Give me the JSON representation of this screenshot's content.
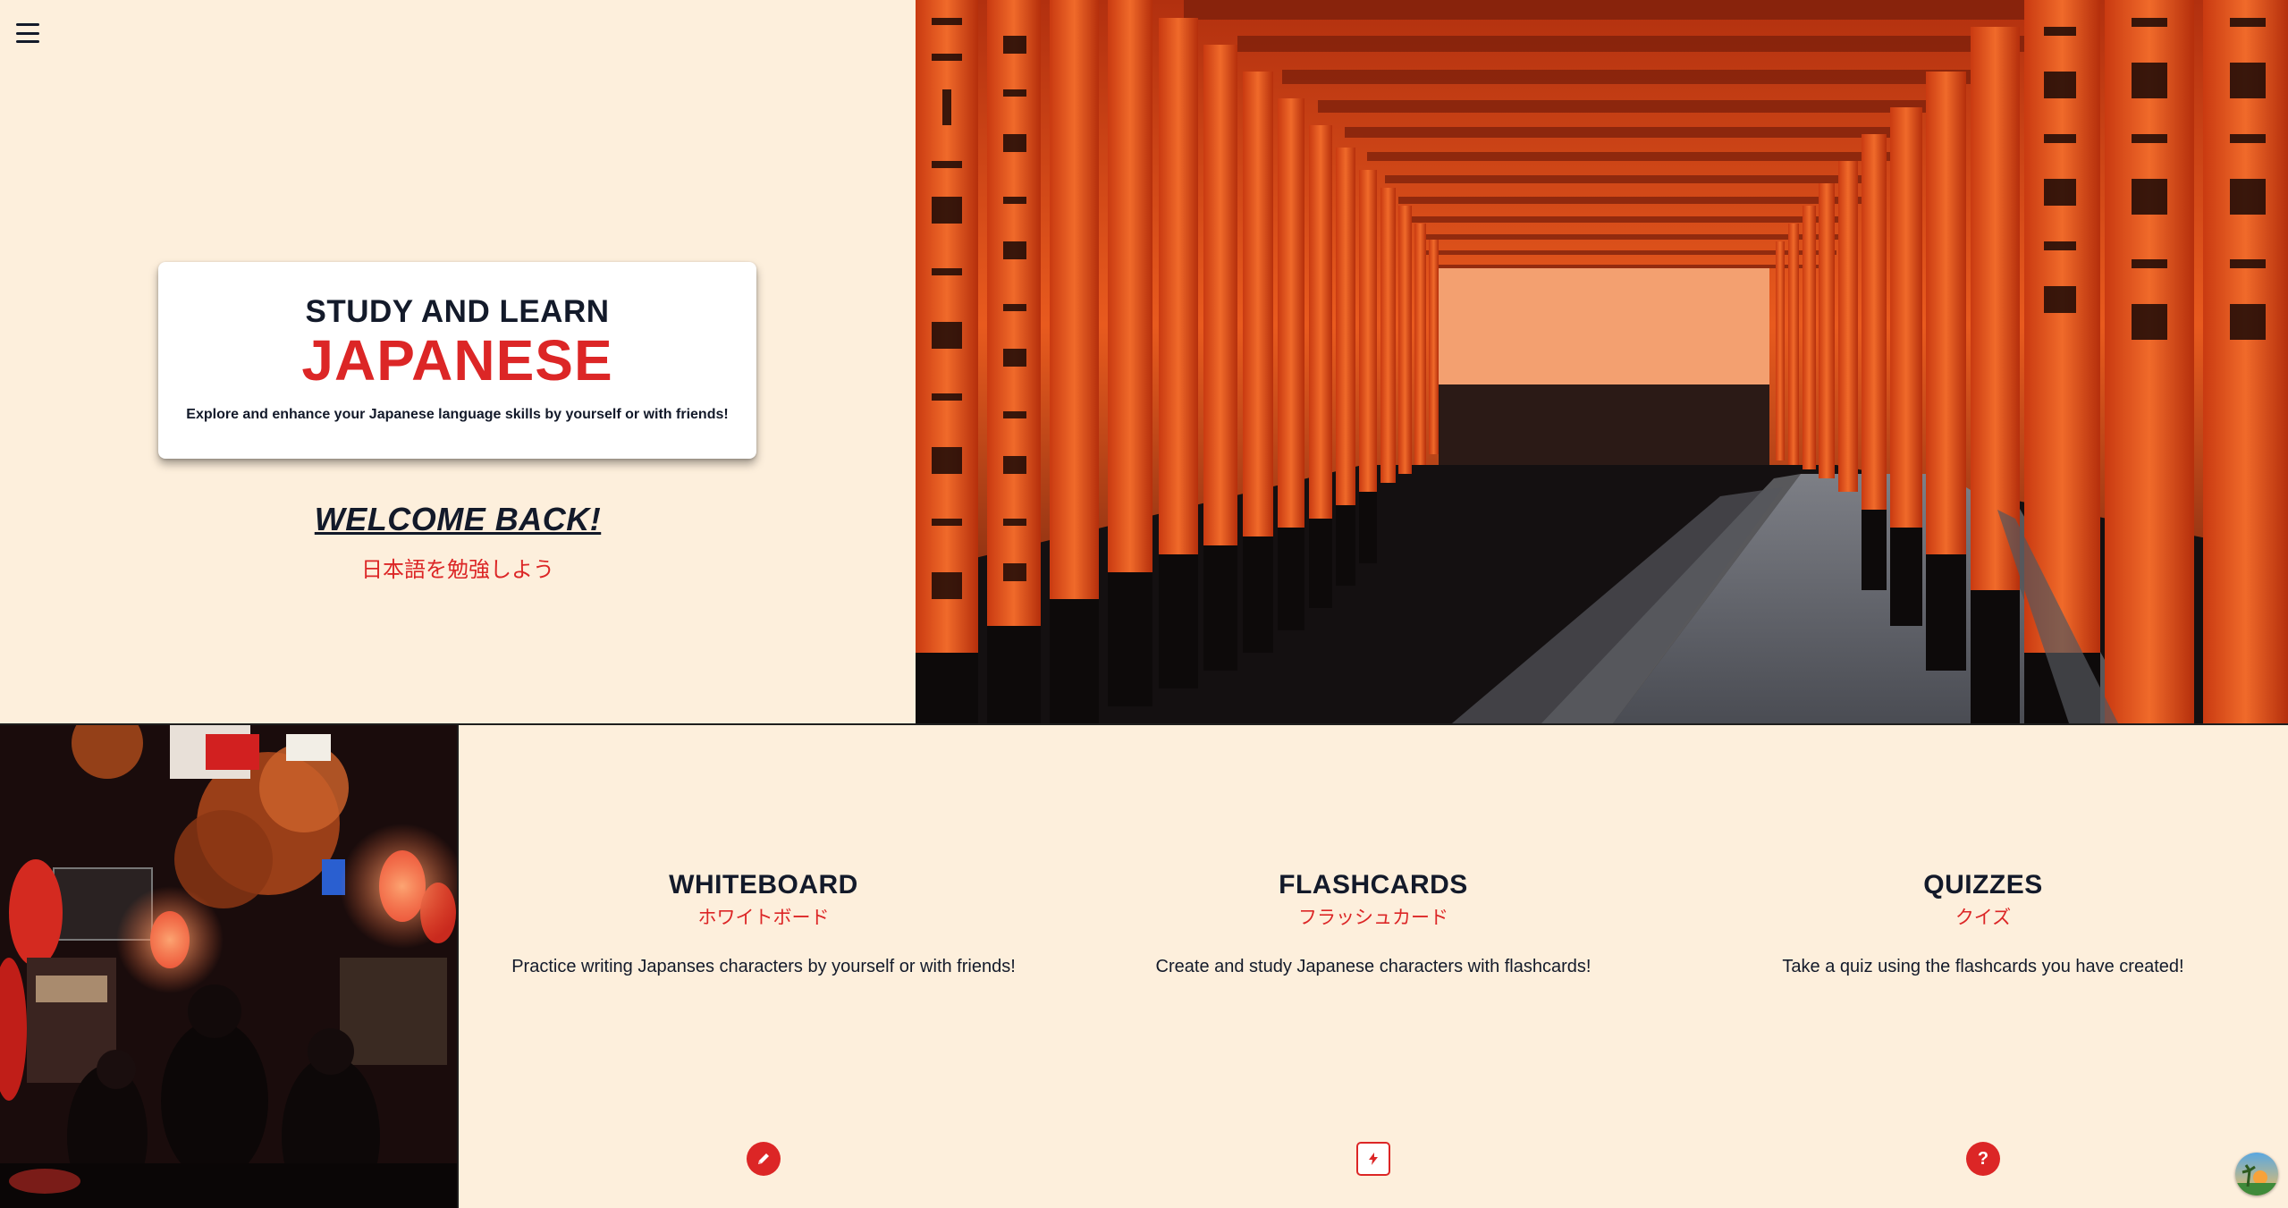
{
  "nav": {
    "menu_icon": "hamburger-menu-icon"
  },
  "hero": {
    "sup_title": "STUDY AND LEARN",
    "main_title": "JAPANESE",
    "description": "Explore and enhance your Japanese language skills by yourself or with friends!"
  },
  "welcome": {
    "title": "WELCOME BACK!",
    "japanese": "日本語を勉強しよう"
  },
  "features": [
    {
      "title": "WHITEBOARD",
      "japanese": "ホワイトボード",
      "description": "Practice writing Japanses characters by yourself or with friends!",
      "icon": "pencil-icon"
    },
    {
      "title": "FLASHCARDS",
      "japanese": "フラッシュカード",
      "description": "Create and study Japanese characters with flashcards!",
      "icon": "lightning-icon"
    },
    {
      "title": "QUIZZES",
      "japanese": "クイズ",
      "description": "Take a quiz using the flashcards you have created!",
      "icon": "question-mark-icon",
      "icon_glyph": "?"
    }
  ],
  "colors": {
    "background": "#fdefdc",
    "accent": "#dc2626",
    "text": "#131a2a"
  }
}
